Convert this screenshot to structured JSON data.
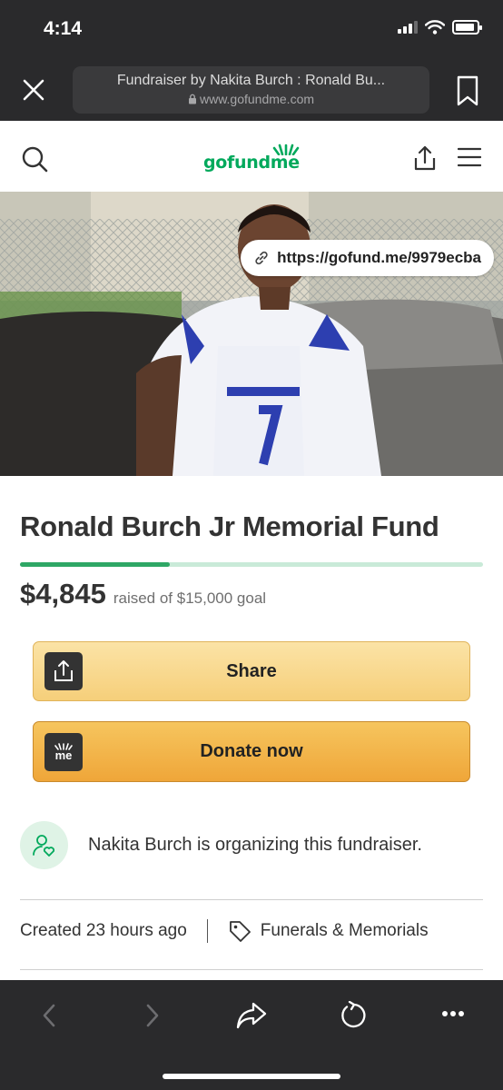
{
  "status": {
    "time": "4:14"
  },
  "browser": {
    "page_title": "Fundraiser by Nakita Burch : Ronald Bu...",
    "domain": "www.gofundme.com"
  },
  "site": {
    "logo": "gofundme"
  },
  "hero": {
    "short_link": "https://gofund.me/9979ecba"
  },
  "campaign": {
    "title": "Ronald Burch Jr Memorial Fund",
    "raised_amount": "$4,845",
    "raised_goal_text": "raised of $15,000 goal",
    "progress_fraction": 0.323
  },
  "buttons": {
    "share": "Share",
    "donate": "Donate now",
    "donate_icon_text": "me"
  },
  "organizer": {
    "text": "Nakita Burch is organizing this fundraiser."
  },
  "meta": {
    "created": "Created 23 hours ago",
    "category": "Funerals & Memorials"
  },
  "colors": {
    "brand_green": "#02a95c",
    "share_button": "#f6cf7a",
    "donate_button": "#efa639",
    "browser_chrome": "#2a2a2c"
  },
  "icons": [
    "close-icon",
    "lock-icon",
    "bookmark-icon",
    "search-icon",
    "share-icon",
    "menu-icon",
    "link-icon",
    "user-heart-icon",
    "tag-icon",
    "back-icon",
    "forward-icon",
    "share-arrow-icon",
    "reload-icon",
    "more-icon"
  ]
}
